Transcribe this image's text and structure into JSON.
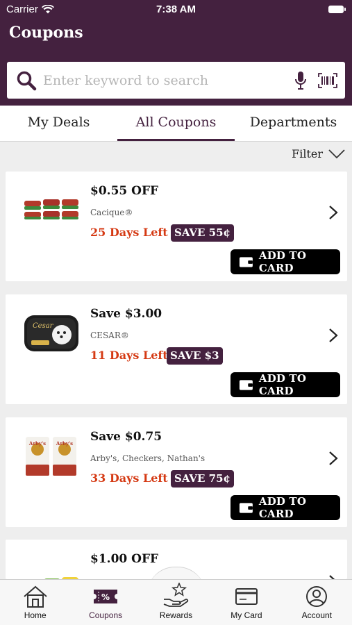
{
  "status_bar": {
    "carrier": "Carrier",
    "time": "7:38 AM"
  },
  "header": {
    "title": "Coupons"
  },
  "search": {
    "placeholder": "Enter keyword to search"
  },
  "tabs": [
    {
      "label": "My Deals",
      "active": false
    },
    {
      "label": "All Coupons",
      "active": true
    },
    {
      "label": "Departments",
      "active": false
    }
  ],
  "filter": {
    "label": "Filter"
  },
  "coupons": [
    {
      "offer": "$0.55 OFF",
      "brand": "Cacique®",
      "days_left": "25 Days Left",
      "save": "SAVE 55¢",
      "button": "ADD TO CARD"
    },
    {
      "offer": "Save $3.00",
      "brand": "CESAR®",
      "days_left": "11 Days Left",
      "save": "SAVE $3",
      "button": "ADD TO CARD"
    },
    {
      "offer": "Save $0.75",
      "brand": "Arby's, Checkers, Nathan's",
      "days_left": "33 Days Left",
      "save": "SAVE 75¢",
      "button": "ADD TO CARD"
    },
    {
      "offer": "$1.00 OFF"
    }
  ],
  "bottom_nav": [
    {
      "label": "Home",
      "icon": "home-icon"
    },
    {
      "label": "Coupons",
      "icon": "coupon-icon",
      "active": true
    },
    {
      "label": "Rewards",
      "icon": "rewards-icon"
    },
    {
      "label": "My Card",
      "icon": "card-icon"
    },
    {
      "label": "Account",
      "icon": "account-icon"
    }
  ],
  "colors": {
    "brand": "#44213f",
    "days_left": "#d53a14",
    "button": "#000000"
  }
}
